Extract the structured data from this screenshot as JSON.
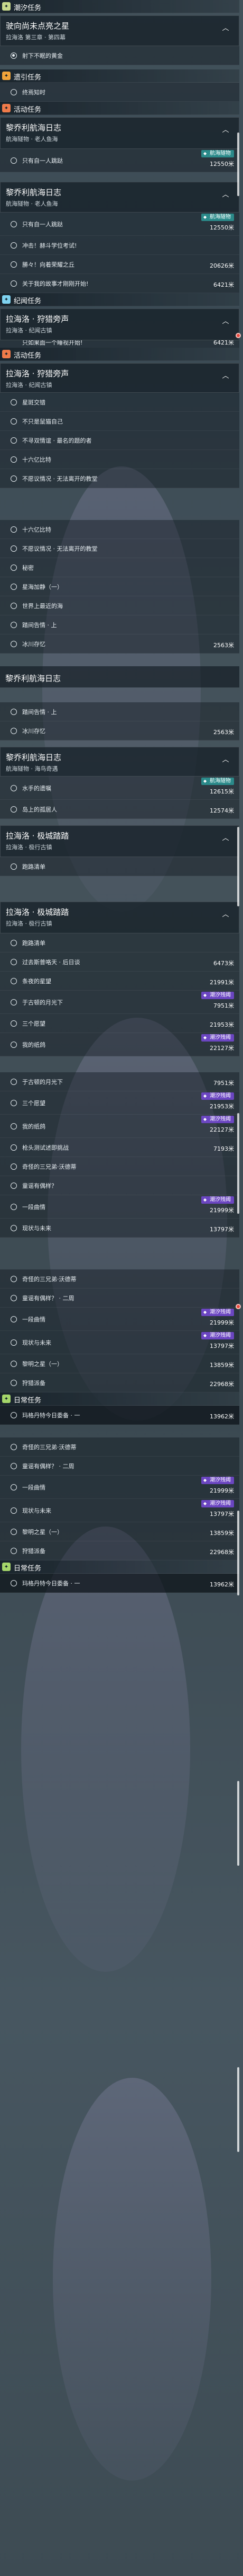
{
  "sections": {
    "chaoxi": "潮汐任务",
    "fengdian": "遗引任务",
    "activity": "活动任务",
    "jiwen": "纪闻任务",
    "daily": "日常任务"
  },
  "q_dawn": {
    "name": "驶向尚未点亮之星",
    "sub": "拉海洛 第三章 · 第四幕",
    "row1": "射下不眠的黄金"
  },
  "q_fengdian_row": "终焉知时",
  "q_voyage": {
    "name": "黎乔利航海日志",
    "sub": "航海隧物 · 老人鱼海",
    "rows": [
      "只有自一人跳跶",
      "冲击！赫斗学位考试!",
      "勝々！向着荣耀之丘",
      "关于我的故事才刚刚开始!"
    ],
    "tags": [
      "航海隧物",
      "航海隧物"
    ],
    "dists": [
      "12550米",
      "12550米",
      "20626米",
      "6421米"
    ],
    "first": "只有自一人跳跶"
  },
  "q_lahai": {
    "name": "拉海洛 · 狩猎旁声",
    "sub": "拉海洛 · 纪闻古镇",
    "cut": "只如果面一个睡视开始!",
    "cut_dist": "6421米",
    "rows": [
      "星斑交错",
      "不只是鼠猫自己",
      "不寻双情谊 · 最名的题的者",
      "十六亿比特",
      "不愿议情况 · 无法离开的教堂",
      "十六亿比特",
      "不愿议情况 · 无法离开的教堂",
      "秘密",
      "星海加静（一）",
      "世界上最近的海",
      "踏间告情 · 上",
      "冰川存忆"
    ],
    "ice_dist": "2563米"
  },
  "q_voyage2": {
    "name": "黎乔利航海日志",
    "rows": [
      "踏间告情 · 上",
      "冰川存忆"
    ],
    "ice_dist": "2563米"
  },
  "q_voyage3": {
    "name": "黎乔利航海日志",
    "sub": "航海隧物 · 海鸟奇遇",
    "tag": "航海隧物",
    "rows": [
      "水手的遗嘱",
      "岛上的孤居人"
    ],
    "dists": [
      "12615米",
      "12574米"
    ]
  },
  "q_yemie": {
    "name": "拉海洛 · 极城踏踏",
    "sub": "拉海洛 · 极行古镇",
    "rows": [
      "跑路清单"
    ]
  },
  "q_yemie2": {
    "name": "拉海洛 · 极城踏踏",
    "sub": "拉海洛 · 极行古镇",
    "rows": [
      "跑路清单",
      "过去斯普咯天 · 后日谈",
      "条夜的星望",
      "于古顿的月光下",
      "三个愿望",
      "我的纸鸽"
    ],
    "tags": [
      "潮汐残阈",
      "潮汐残阈"
    ],
    "dists": [
      "6473米",
      "21991米",
      "7951米",
      "21953米",
      "22127米"
    ]
  },
  "daily_a": {
    "rows": [
      "于古顿的月光下",
      "三个愿望",
      "我的纸鸽",
      "枪头测试述即挑战",
      "奇怪的三兄弟·沃德蒂",
      "童谣有偶样？",
      "一段曲情",
      "现状与未来"
    ],
    "tags": [
      "潮汐残阈",
      "潮汐残阈",
      "潮汐残阈"
    ],
    "dists": [
      "7951米",
      "21953米",
      "22127米",
      "7193米",
      "21999米",
      "13797米"
    ]
  },
  "daily_b": {
    "rows": [
      "奇怪的三兄弟·沃德蒂",
      "童谣有偶样？ · 二周",
      "一段曲情",
      "现状与未来",
      "黎明之星（一）",
      "狩猎派备"
    ],
    "tags": [
      "潮汐残阈",
      "潮汐残阈"
    ],
    "dists": [
      "21999米",
      "13797米",
      "13859米",
      "22968米"
    ]
  },
  "daily_title": "日常任务",
  "daily_first": "玛格丹特今日委备 · 一",
  "daily_first_dist": "13962米",
  "daily_c": {
    "rows": [
      "奇怪的三兄弟·沃德蒂",
      "童谣有偶样？ · 二周",
      "一段曲情",
      "现状与未来",
      "黎明之星（一）",
      "狩猎派备"
    ],
    "tags": [
      "潮汐残阈",
      "潮汐残阈"
    ],
    "dists": [
      "21999米",
      "13797米",
      "13859米",
      "22968米"
    ]
  },
  "daily_last": "玛格丹特今日委备 · 一",
  "daily_last_dist": "13962米",
  "colors": {
    "chaoxi": "#c8d98c",
    "fengdian": "#f0a33a",
    "activity": "#f07b4a",
    "jiwen": "#7fd3f0",
    "daily": "#a5d66a",
    "teal_tag": "#2b8a8a",
    "purple_tag": "#6b46c1"
  },
  "icons": [
    "plus-icon",
    "chevron-up-icon",
    "chevron-down-icon",
    "ring-icon",
    "red-marker-icon"
  ]
}
